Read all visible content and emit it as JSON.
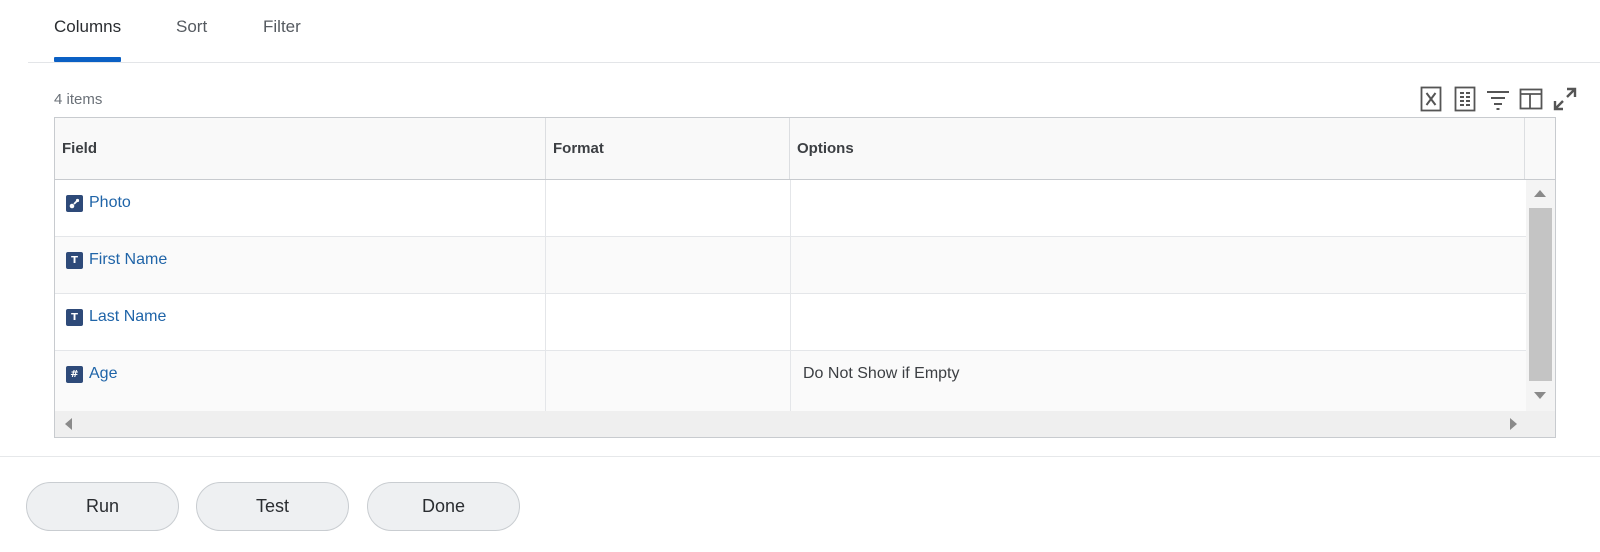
{
  "tabs": [
    {
      "label": "Columns",
      "active": true
    },
    {
      "label": "Sort",
      "active": false
    },
    {
      "label": "Filter",
      "active": false
    }
  ],
  "items_count": "4 items",
  "toolbar": {
    "icons": [
      "export-excel-icon",
      "export-pdf-icon",
      "filter-icon",
      "column-layout-icon",
      "expand-icon"
    ]
  },
  "table": {
    "headers": [
      "Field",
      "Format",
      "Options"
    ],
    "rows": [
      {
        "field": "Photo",
        "type_icon": "image-icon",
        "type_glyph": "",
        "format": "",
        "options": ""
      },
      {
        "field": "First Name",
        "type_icon": "text-type-icon",
        "type_glyph": "T",
        "format": "",
        "options": ""
      },
      {
        "field": "Last Name",
        "type_icon": "text-type-icon",
        "type_glyph": "T",
        "format": "",
        "options": ""
      },
      {
        "field": "Age",
        "type_icon": "number-type-icon",
        "type_glyph": "#",
        "format": "",
        "options": "Do Not Show if Empty"
      }
    ]
  },
  "buttons": {
    "run": "Run",
    "test": "Test",
    "done": "Done"
  },
  "colors": {
    "accent": "#0b60c4",
    "link": "#1f64a8",
    "type_icon_bg": "#2e4a79"
  }
}
